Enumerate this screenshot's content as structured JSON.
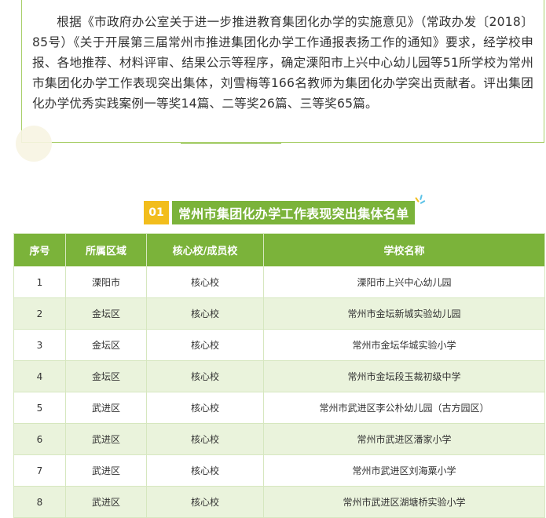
{
  "intro": {
    "paragraph": "根据《市政府办公室关于进一步推进教育集团化办学的实施意见》（常政办发〔2018〕85号）《关于开展第三届常州市推进集团化办学工作通报表扬工作的通知》要求，经学校申报、各地推荐、材料评审、结果公示等程序，确定溧阳市上兴中心幼儿园等51所学校为常州市集团化办学工作表现突出集体，刘雪梅等166名教师为集团化办学突出贡献者。评出集团化办学优秀实践案例一等奖14篇、二等奖26篇、三等奖65篇。"
  },
  "section": {
    "number": "01",
    "title": "常州市集团化办学工作表现突出集体名单"
  },
  "table": {
    "headers": [
      "序号",
      "所属区域",
      "核心校/成员校",
      "学校名称"
    ],
    "rows": [
      [
        "1",
        "溧阳市",
        "核心校",
        "溧阳市上兴中心幼儿园"
      ],
      [
        "2",
        "金坛区",
        "核心校",
        "常州市金坛新城实验幼儿园"
      ],
      [
        "3",
        "金坛区",
        "核心校",
        "常州市金坛华城实验小学"
      ],
      [
        "4",
        "金坛区",
        "核心校",
        "常州市金坛段玉裁初级中学"
      ],
      [
        "5",
        "武进区",
        "核心校",
        "常州市武进区李公朴幼儿园（古方园区）"
      ],
      [
        "6",
        "武进区",
        "核心校",
        "常州市武进区潘家小学"
      ],
      [
        "7",
        "武进区",
        "核心校",
        "常州市武进区刘海粟小学"
      ],
      [
        "8",
        "武进区",
        "核心校",
        "常州市武进区湖塘桥实验小学"
      ]
    ]
  },
  "colors": {
    "accent_green": "#7bb33a",
    "alt_row": "#eaf3dc",
    "badge_yellow": "#f2bd1c"
  }
}
